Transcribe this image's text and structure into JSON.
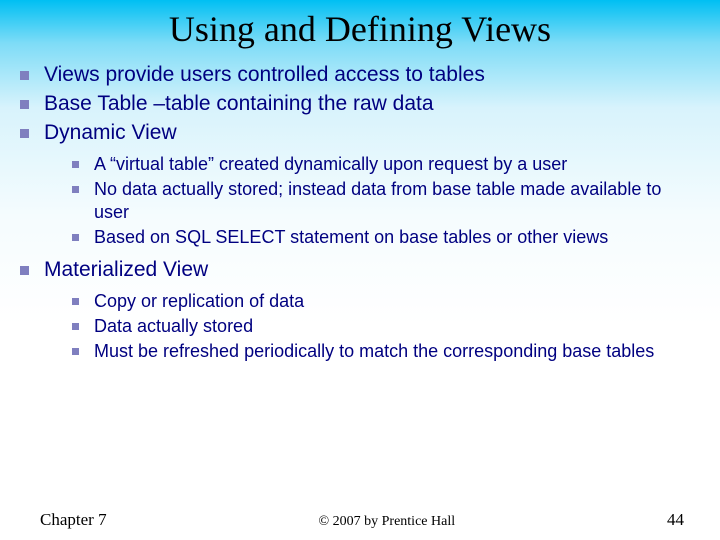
{
  "title": "Using and Defining Views",
  "bullets": {
    "b0": "Views provide users controlled access to tables",
    "b1": "Base Table –table containing the raw data",
    "b2": "Dynamic View",
    "b3": "Materialized View"
  },
  "dynamic": {
    "d0": "A “virtual table” created dynamically upon request by a user",
    "d1": "No data actually stored; instead data from base table made available to user",
    "d2": "Based on SQL SELECT statement on base tables or other views"
  },
  "material": {
    "m0": "Copy or replication of data",
    "m1": "Data actually stored",
    "m2": "Must be refreshed periodically to match the corresponding base tables"
  },
  "footer": {
    "chapter": "Chapter 7",
    "copyright": "© 2007 by Prentice Hall",
    "page": "44"
  }
}
